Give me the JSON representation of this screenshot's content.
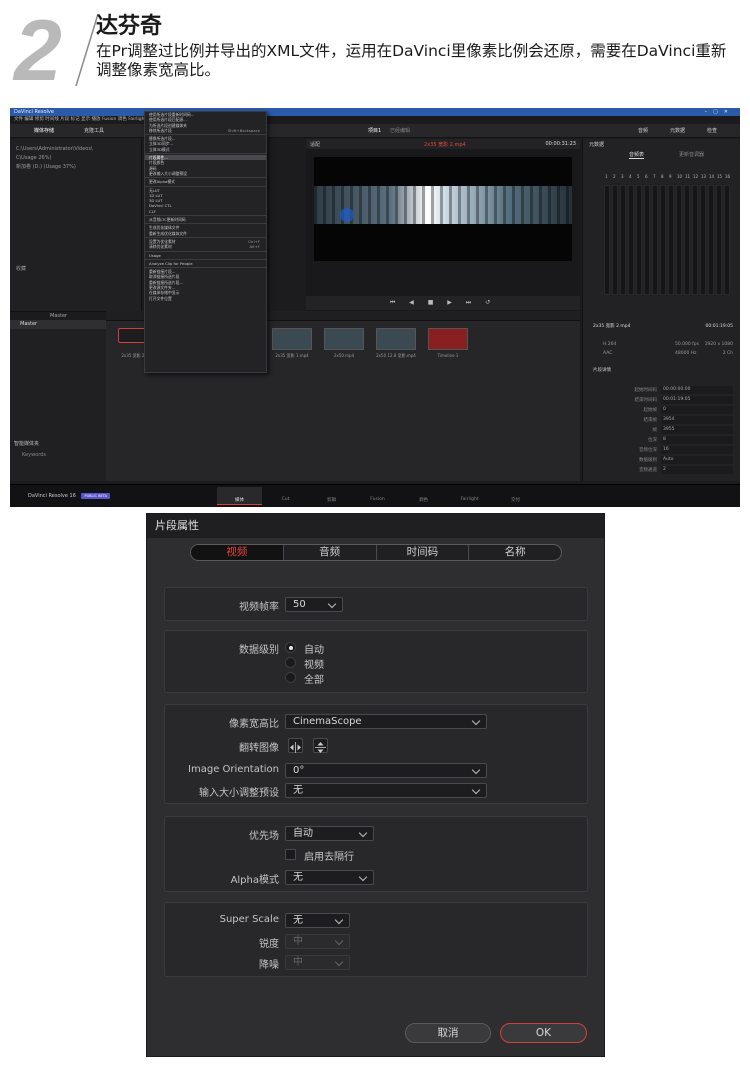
{
  "header": {
    "step_number": "2",
    "author": "达芬奇",
    "description": "在Pr调整过比例并导出的XML文件，运用在DaVinci里像素比例会还原，需要在DaVinci重新调整像素宽高比。"
  },
  "resolve": {
    "app_title": "DaVinci Resolve",
    "menu_bar": [
      "文件",
      "编辑",
      "修剪",
      "时间线",
      "片段",
      "标记",
      "显示",
      "播放",
      "Fusion",
      "调色",
      "Fairlight",
      "工作区",
      "帮助"
    ],
    "toolbar": {
      "media_pool": "媒体存储",
      "effects": "克隆工具",
      "project_name": "项目1",
      "edited_status": "已经编辑",
      "audio": "音频",
      "metadata": "元数据",
      "inspector": "检查"
    },
    "drives": [
      "C:\\Users\\Administrator\\Videos\\",
      "C\\Usage 26%)",
      "新加卷 (D:) (Usage 37%)"
    ],
    "favorites_label": "收藏",
    "smart_bins_label": "智能媒体夹",
    "keywords_label": "Keywords",
    "bin_label": "Master",
    "viewer": {
      "zoom": "适配",
      "clip_name": "2x35 宽影 2.mp4",
      "timecode": "00:00:31:23"
    },
    "audio_panel": {
      "title": "元数据",
      "tabs": [
        "音频表",
        "更新音调器"
      ],
      "channels": [
        "1",
        "2",
        "3",
        "4",
        "5",
        "6",
        "7",
        "8",
        "9",
        "10",
        "11",
        "12",
        "13",
        "14",
        "15",
        "16"
      ]
    },
    "context_menu": [
      "使用所选片段重新时间码...",
      "使用所选片段匹配源...",
      "为所选片段创建媒体夹",
      "移除所选片段",
      "替换所选片段...",
      "立体3D同步...",
      "立体3D模式",
      "片段属性...",
      "片段颜色",
      "源码",
      "更改输入大小调整预设",
      "更改Alpha模式",
      "无LUT",
      "1D LUT",
      "3D LUT",
      "DaVinci CTL",
      "CLF",
      "从音频LTC更新时间码",
      "生成优化媒体文件",
      "重新生成优化媒体文件",
      "设置为优化素材",
      "清除优化素材",
      "Usage",
      "Analyze Clip for People",
      "重新链接片段...",
      "取消链接所选片段",
      "重新链接所选片段...",
      "更改源文件夹...",
      "在媒体存储中显示",
      "打开文件位置"
    ],
    "context_shortcuts": {
      "remove": "Shift+Backspace",
      "set_opt": "Ctrl+F",
      "clear_opt": "Alt+F"
    },
    "thumbnails": [
      "2x35 宽影 2.mp4",
      "2x35 宽影 1.mp4",
      "2x50.mp4",
      "2x50 12.8 宽影.mp4",
      "Timeline 1"
    ],
    "metadata": {
      "clip_name": "2x35 宽影 2.mp4",
      "clip_duration": "00:01:19:05",
      "codec": "H.264",
      "fps": "50.000 fps",
      "resolution": "1920 x 1080",
      "audio_codec": "AAC",
      "sample_rate": "48000 Hz",
      "audio_ch": "2 Ch",
      "section_title": "片段详情",
      "fields": [
        {
          "k": "起始时间码",
          "v": "00:00:00:00"
        },
        {
          "k": "结束时间码",
          "v": "00:01:19:05"
        },
        {
          "k": "起始帧",
          "v": "0"
        },
        {
          "k": "结束帧",
          "v": "3954"
        },
        {
          "k": "帧",
          "v": "3955"
        },
        {
          "k": "位深",
          "v": "8"
        },
        {
          "k": "音频位深",
          "v": "16"
        },
        {
          "k": "数据级别",
          "v": "Auto"
        },
        {
          "k": "音频通道",
          "v": "2"
        }
      ]
    },
    "footer": {
      "app": "DaVinci Resolve 16",
      "beta": "PUBLIC BETA"
    },
    "pages": [
      "媒体",
      "Cut",
      "剪辑",
      "Fusion",
      "调色",
      "Fairlight",
      "交付"
    ]
  },
  "dialog": {
    "title": "片段属性",
    "tabs": [
      "视频",
      "音频",
      "时间码",
      "名称"
    ],
    "video_fps_label": "视频帧率",
    "video_fps_value": "50",
    "data_level_label": "数据级别",
    "data_level_options": [
      "自动",
      "视频",
      "全部"
    ],
    "pixel_aspect_label": "像素宽高比",
    "pixel_aspect_value": "CinemaScope",
    "flip_label": "翻转图像",
    "orientation_label": "Image Orientation",
    "orientation_value": "0°",
    "input_sizing_label": "输入大小调整预设",
    "input_sizing_value": "无",
    "field_dominance_label": "优先场",
    "field_dominance_value": "自动",
    "deinterlace_label": "启用去隔行",
    "alpha_label": "Alpha模式",
    "alpha_value": "无",
    "superscale_label": "Super Scale",
    "superscale_value": "无",
    "sharpness_label": "锐度",
    "sharpness_value": "中",
    "noise_label": "降噪",
    "noise_value": "中",
    "cancel": "取消",
    "ok": "OK"
  },
  "colors": {
    "accent_red": "#e6453d",
    "title_blue": "#2b5aa8",
    "beta_purple": "#5855c9"
  }
}
